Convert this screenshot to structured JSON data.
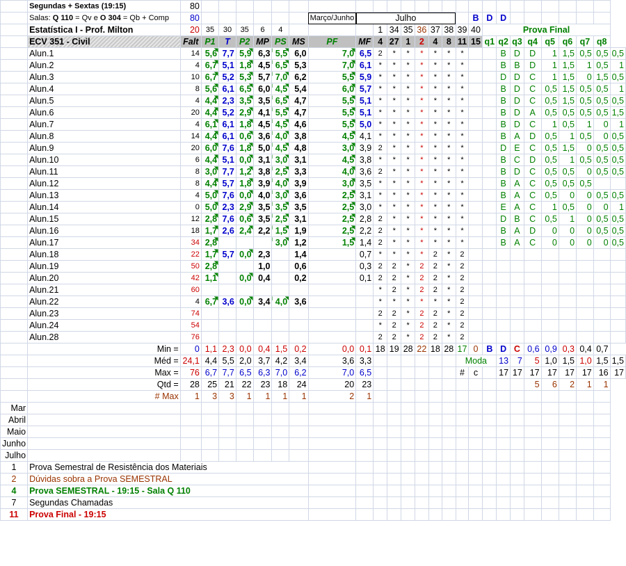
{
  "header": {
    "schedule": "Segundas + Sextas (19:15)",
    "rooms_prefix": "Salas: ",
    "rooms_q": "Q 110",
    "rooms_mid": " = Qv e ",
    "rooms_o": "O 304",
    "rooms_suffix": " = Qb + Comp",
    "course_title": "Estatística I - Prof. Milton",
    "class_label": "ECV 351 - Civil",
    "v80a": "80",
    "v80b": "80",
    "v20": "20",
    "weights": [
      "35",
      "30",
      "35",
      "6",
      "4"
    ],
    "month_a": "Março/Junho",
    "month_b": "Julho",
    "calendar_top": [
      "1",
      "34",
      "35",
      "36",
      "37",
      "38",
      "39",
      "40"
    ],
    "answer_key": [
      "B",
      "D",
      "D"
    ],
    "prova_final": "Prova Final",
    "columns": [
      "Falt",
      "P1",
      "T",
      "P2",
      "MP",
      "PS",
      "MS",
      "PF",
      "MF"
    ],
    "day_cols": [
      "4",
      "27",
      "1",
      "2",
      "4",
      "8",
      "11",
      "15"
    ],
    "q_cols": [
      "q1",
      "q2",
      "q3",
      "q4",
      "q5",
      "q6",
      "q7",
      "q8"
    ]
  },
  "students": [
    {
      "n": "Alun.1",
      "f": "14",
      "g": [
        "5,6",
        "7,7",
        "5,9",
        "6,3",
        "5,5",
        "6,0",
        "7,0",
        "6,5"
      ],
      "a": [
        "2",
        "*",
        "*",
        "*",
        "*",
        "*",
        "*",
        ""
      ],
      "q": [
        "B",
        "D",
        "D",
        "1",
        "1,5",
        "0,5",
        "0,5",
        "0,5"
      ]
    },
    {
      "n": "Alun.2",
      "f": "4",
      "g": [
        "6,7",
        "5,1",
        "1,8",
        "4,5",
        "6,5",
        "5,3",
        "7,0",
        "6,1"
      ],
      "a": [
        "*",
        "*",
        "*",
        "*",
        "*",
        "*",
        "*",
        ""
      ],
      "q": [
        "B",
        "B",
        "D",
        "1",
        "1,5",
        "1",
        "0,5",
        "1"
      ]
    },
    {
      "n": "Alun.3",
      "f": "10",
      "g": [
        "6,7",
        "5,2",
        "5,3",
        "5,7",
        "7,0",
        "6,2",
        "5,5",
        "5,9"
      ],
      "a": [
        "*",
        "*",
        "*",
        "*",
        "*",
        "*",
        "*",
        ""
      ],
      "q": [
        "D",
        "D",
        "C",
        "1",
        "1,5",
        "0",
        "1,5",
        "0,5"
      ]
    },
    {
      "n": "Alun.4",
      "f": "8",
      "g": [
        "5,6",
        "6,1",
        "6,5",
        "6,0",
        "4,5",
        "5,4",
        "6,0",
        "5,7"
      ],
      "a": [
        "*",
        "*",
        "*",
        "*",
        "*",
        "*",
        "*",
        ""
      ],
      "q": [
        "B",
        "D",
        "C",
        "0,5",
        "1,5",
        "0,5",
        "0,5",
        "1"
      ]
    },
    {
      "n": "Alun.5",
      "f": "4",
      "g": [
        "4,4",
        "2,3",
        "3,5",
        "3,5",
        "6,5",
        "4,7",
        "5,5",
        "5,1"
      ],
      "a": [
        "*",
        "*",
        "*",
        "*",
        "*",
        "*",
        "*",
        ""
      ],
      "q": [
        "B",
        "D",
        "C",
        "0,5",
        "1,5",
        "0,5",
        "0,5",
        "0,5"
      ]
    },
    {
      "n": "Alun.6",
      "f": "20",
      "g": [
        "4,4",
        "5,2",
        "2,9",
        "4,1",
        "5,5",
        "4,7",
        "5,5",
        "5,1"
      ],
      "a": [
        "*",
        "*",
        "*",
        "*",
        "*",
        "*",
        "*",
        ""
      ],
      "q": [
        "B",
        "D",
        "A",
        "0,5",
        "0,5",
        "0,5",
        "0,5",
        "1,5"
      ]
    },
    {
      "n": "Alun.7",
      "f": "4",
      "g": [
        "6,1",
        "6,1",
        "1,8",
        "4,5",
        "4,5",
        "4,6",
        "5,5",
        "5,0"
      ],
      "a": [
        "*",
        "*",
        "*",
        "*",
        "*",
        "*",
        "*",
        ""
      ],
      "q": [
        "B",
        "D",
        "C",
        "1",
        "0,5",
        "1",
        "0",
        "1"
      ]
    },
    {
      "n": "Alun.8",
      "f": "14",
      "g": [
        "4,4",
        "6,1",
        "0,6",
        "3,6",
        "4,0",
        "3,8",
        "4,5",
        "4,1"
      ],
      "a": [
        "*",
        "*",
        "*",
        "*",
        "*",
        "*",
        "*",
        ""
      ],
      "q": [
        "B",
        "A",
        "D",
        "0,5",
        "1",
        "0,5",
        "0",
        "0,5"
      ]
    },
    {
      "n": "Alun.9",
      "f": "20",
      "g": [
        "6,0",
        "7,6",
        "1,8",
        "5,0",
        "4,5",
        "4,8",
        "3,0",
        "3,9"
      ],
      "a": [
        "2",
        "*",
        "*",
        "*",
        "*",
        "*",
        "*",
        ""
      ],
      "q": [
        "D",
        "E",
        "C",
        "0,5",
        "1,5",
        "0",
        "0,5",
        "0,5"
      ]
    },
    {
      "n": "Alun.10",
      "f": "6",
      "g": [
        "4,4",
        "5,1",
        "0,0",
        "3,1",
        "3,0",
        "3,1",
        "4,5",
        "3,8"
      ],
      "a": [
        "*",
        "*",
        "*",
        "*",
        "*",
        "*",
        "*",
        ""
      ],
      "q": [
        "B",
        "C",
        "D",
        "0,5",
        "1",
        "0,5",
        "0,5",
        "0,5"
      ]
    },
    {
      "n": "Alun.11",
      "f": "8",
      "g": [
        "3,0",
        "7,7",
        "1,2",
        "3,8",
        "2,5",
        "3,3",
        "4,0",
        "3,6"
      ],
      "a": [
        "2",
        "*",
        "*",
        "*",
        "*",
        "*",
        "*",
        ""
      ],
      "q": [
        "B",
        "D",
        "C",
        "0,5",
        "0,5",
        "0",
        "0,5",
        "0,5"
      ]
    },
    {
      "n": "Alun.12",
      "f": "8",
      "g": [
        "4,4",
        "5,7",
        "1,8",
        "3,9",
        "4,0",
        "3,9",
        "3,0",
        "3,5"
      ],
      "a": [
        "*",
        "*",
        "*",
        "*",
        "*",
        "*",
        "*",
        ""
      ],
      "q": [
        "B",
        "A",
        "C",
        "0,5",
        "0,5",
        "0,5",
        "",
        ""
      ]
    },
    {
      "n": "Alun.13",
      "f": "4",
      "g": [
        "5,0",
        "7,6",
        "0,0",
        "4,0",
        "3,0",
        "3,6",
        "2,5",
        "3,1"
      ],
      "a": [
        "*",
        "*",
        "*",
        "*",
        "*",
        "*",
        "*",
        ""
      ],
      "q": [
        "B",
        "A",
        "C",
        "0,5",
        "0",
        "0",
        "0,5",
        "0,5"
      ]
    },
    {
      "n": "Alun.14",
      "f": "0",
      "g": [
        "5,0",
        "2,3",
        "2,9",
        "3,5",
        "3,5",
        "3,5",
        "2,5",
        "3,0"
      ],
      "a": [
        "*",
        "*",
        "*",
        "*",
        "*",
        "*",
        "*",
        ""
      ],
      "q": [
        "E",
        "A",
        "C",
        "1",
        "0,5",
        "0",
        "0",
        "1"
      ]
    },
    {
      "n": "Alun.15",
      "f": "12",
      "g": [
        "2,8",
        "7,6",
        "0,6",
        "3,5",
        "2,5",
        "3,1",
        "2,5",
        "2,8"
      ],
      "a": [
        "2",
        "*",
        "*",
        "*",
        "*",
        "*",
        "*",
        ""
      ],
      "q": [
        "D",
        "B",
        "C",
        "0,5",
        "1",
        "0",
        "0,5",
        "0,5"
      ]
    },
    {
      "n": "Alun.16",
      "f": "18",
      "g": [
        "1,7",
        "2,6",
        "2,4",
        "2,2",
        "1,5",
        "1,9",
        "2,5",
        "2,2"
      ],
      "a": [
        "2",
        "*",
        "*",
        "*",
        "*",
        "*",
        "*",
        ""
      ],
      "q": [
        "B",
        "A",
        "D",
        "0",
        "0",
        "0",
        "0,5",
        "0,5"
      ]
    },
    {
      "n": "Alun.17",
      "f": "34",
      "g": [
        "2,8",
        "",
        "",
        "",
        "3,0",
        "1,2",
        "1,5",
        "1,4"
      ],
      "a": [
        "2",
        "*",
        "*",
        "*",
        "*",
        "*",
        "*",
        ""
      ],
      "q": [
        "B",
        "A",
        "C",
        "0",
        "0",
        "0",
        "0",
        "0,5"
      ]
    },
    {
      "n": "Alun.18",
      "f": "22",
      "g": [
        "1,7",
        "5,7",
        "0,0",
        "2,3",
        "",
        "1,4",
        "",
        "0,7"
      ],
      "a": [
        "*",
        "*",
        "*",
        "*",
        "2",
        "*",
        "2",
        ""
      ],
      "q": [
        "",
        "",
        "",
        "",
        "",
        "",
        "",
        ""
      ]
    },
    {
      "n": "Alun.19",
      "f": "50",
      "g": [
        "2,8",
        "",
        "",
        "1,0",
        "",
        "0,6",
        "",
        "0,3"
      ],
      "a": [
        "2",
        "2",
        "*",
        "2",
        "2",
        "*",
        "2",
        ""
      ],
      "q": [
        "",
        "",
        "",
        "",
        "",
        "",
        "",
        ""
      ]
    },
    {
      "n": "Alun.20",
      "f": "42",
      "g": [
        "1,1",
        "",
        "0,0",
        "0,4",
        "",
        "0,2",
        "",
        "0,1"
      ],
      "a": [
        "2",
        "2",
        "*",
        "2",
        "2",
        "*",
        "2",
        ""
      ],
      "q": [
        "",
        "",
        "",
        "",
        "",
        "",
        "",
        ""
      ]
    },
    {
      "n": "Alun.21",
      "f": "60",
      "g": [
        "",
        "",
        "",
        "",
        "",
        "",
        "",
        ""
      ],
      "a": [
        "*",
        "2",
        "*",
        "2",
        "2",
        "*",
        "2",
        ""
      ],
      "q": [
        "",
        "",
        "",
        "",
        "",
        "",
        "",
        ""
      ]
    },
    {
      "n": "Alun.22",
      "f": "4",
      "g": [
        "6,7",
        "3,6",
        "0,0",
        "3,4",
        "4,0",
        "3,6",
        "",
        ""
      ],
      "a": [
        "*",
        "*",
        "*",
        "*",
        "*",
        "*",
        "2",
        ""
      ],
      "q": [
        "",
        "",
        "",
        "",
        "",
        "",
        "",
        ""
      ]
    },
    {
      "n": "Alun.23",
      "f": "74",
      "g": [
        "",
        "",
        "",
        "",
        "",
        "",
        "",
        ""
      ],
      "a": [
        "2",
        "2",
        "*",
        "2",
        "2",
        "*",
        "2",
        ""
      ],
      "q": [
        "",
        "",
        "",
        "",
        "",
        "",
        "",
        ""
      ]
    },
    {
      "n": "Alun.24",
      "f": "54",
      "g": [
        "",
        "",
        "",
        "",
        "",
        "",
        "",
        ""
      ],
      "a": [
        "*",
        "2",
        "*",
        "2",
        "2",
        "*",
        "2",
        ""
      ],
      "q": [
        "",
        "",
        "",
        "",
        "",
        "",
        "",
        ""
      ]
    },
    {
      "n": "Alun.28",
      "f": "76",
      "g": [
        "",
        "",
        "",
        "",
        "",
        "",
        "",
        ""
      ],
      "a": [
        "2",
        "2",
        "*",
        "2",
        "2",
        "*",
        "2",
        ""
      ],
      "q": [
        "",
        "",
        "",
        "",
        "",
        "",
        "",
        ""
      ]
    }
  ],
  "summary": {
    "min_label": "Min =",
    "min": [
      "0",
      "1,1",
      "2,3",
      "0,0",
      "0,4",
      "1,5",
      "0,2",
      "0,0",
      "0,1"
    ],
    "min_days": [
      "18",
      "19",
      "28",
      "22",
      "18",
      "28",
      "17",
      "0"
    ],
    "min_q": [
      "B",
      "D",
      "C",
      "0,6",
      "0,9",
      "0,3",
      "0,4",
      "0,7"
    ],
    "med_label": "Méd =",
    "med": [
      "24,1",
      "4,4",
      "5,5",
      "2,0",
      "3,7",
      "4,2",
      "3,4",
      "3,6",
      "3,3"
    ],
    "moda_label": "Moda",
    "moda": [
      "13",
      "7",
      "5",
      "1,0",
      "1,5",
      "1,0",
      "1,5",
      "1,5"
    ],
    "max_label": "Max =",
    "max": [
      "76",
      "6,7",
      "7,7",
      "6,5",
      "6,3",
      "7,0",
      "6,2",
      "7,0",
      "6,5"
    ],
    "hash_label": "#",
    "c_label": "c",
    "counts_q": [
      "17",
      "17",
      "17",
      "17",
      "17",
      "17",
      "16",
      "17"
    ],
    "qtd_label": "Qtd =",
    "qtd": [
      "28",
      "25",
      "21",
      "22",
      "23",
      "18",
      "24",
      "20",
      "23"
    ],
    "qtd_q": [
      "5",
      "6",
      "2",
      "1",
      "1"
    ],
    "nmax_label": "# Max",
    "nmax": [
      "1",
      "3",
      "3",
      "1",
      "1",
      "1",
      "1",
      "2",
      "1"
    ]
  },
  "months": [
    "Mar",
    "Abril",
    "Maio",
    "Junho",
    "Julho"
  ],
  "legend": [
    {
      "num": "1",
      "text": "Prova Semestral de Resistência dos Materiais"
    },
    {
      "num": "2",
      "text": "Dúvidas sobra a Prova SEMESTRAL"
    },
    {
      "num": "4",
      "text": "Prova SEMESTRAL - 19:15 - Sala Q 110"
    },
    {
      "num": "7",
      "text": "Segundas Chamadas"
    },
    {
      "num": "11",
      "text": "Prova Final - 19:15"
    }
  ],
  "colors": {
    "green": "#008000",
    "blue": "#0000cc",
    "red": "#cc0000",
    "brown": "#993300",
    "header_gray": "#c0c0c0"
  }
}
